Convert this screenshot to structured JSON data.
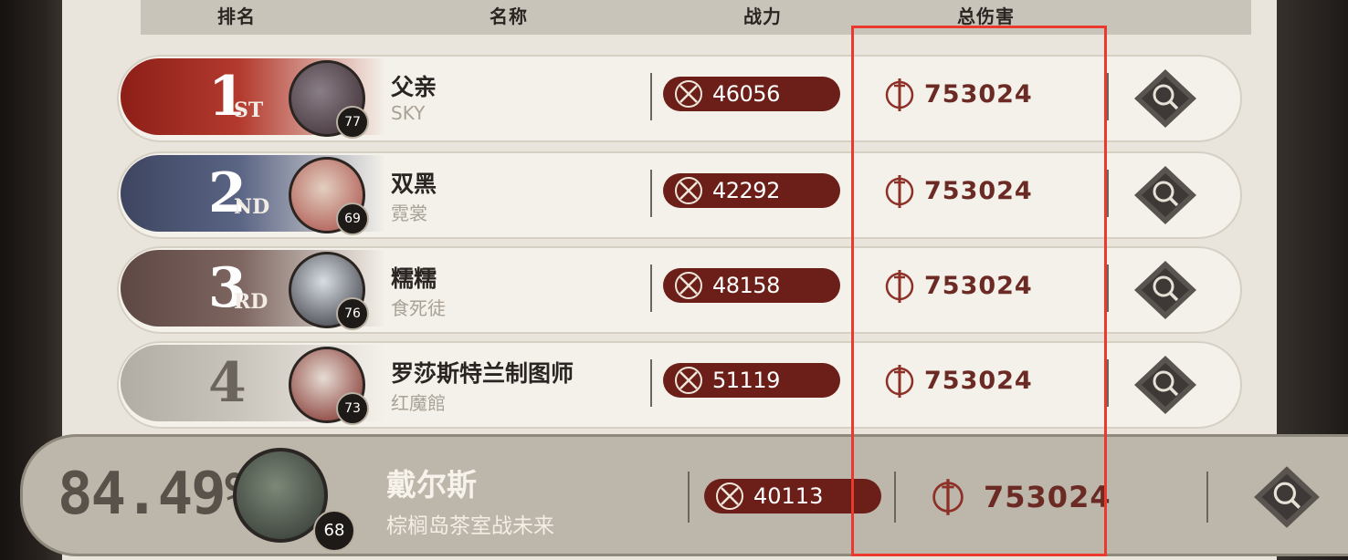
{
  "header": {
    "col_rank": "排名",
    "col_name": "名称",
    "col_power": "战力",
    "col_damage": "总伤害"
  },
  "rows": [
    {
      "rank_num": "1",
      "rank_suffix": "ST",
      "name": "父亲",
      "guild": "SKY",
      "level": "77",
      "power": "46056",
      "damage": "753024",
      "badge_color": "#9f2a22"
    },
    {
      "rank_num": "2",
      "rank_suffix": "ND",
      "name": "双黑",
      "guild": "霓裳",
      "level": "69",
      "power": "42292",
      "damage": "753024",
      "badge_color": "#4c5570"
    },
    {
      "rank_num": "3",
      "rank_suffix": "RD",
      "name": "糯糯",
      "guild": "食死徒",
      "level": "76",
      "power": "48158",
      "damage": "753024",
      "badge_color": "#6e5852"
    },
    {
      "rank_num": "4",
      "rank_suffix": "",
      "name": "罗莎斯特兰制图师",
      "guild": "红魔館",
      "level": "73",
      "power": "51119",
      "damage": "753024",
      "badge_color": "#b5b0a8"
    }
  ],
  "mine": {
    "percent": "84.49%",
    "name": "戴尔斯",
    "guild": "棕榈岛茶室战未来",
    "level": "68",
    "power": "40113",
    "damage": "753024"
  },
  "icons": {
    "power": "crossed-swords-icon",
    "damage": "dagger-shield-icon",
    "inspect": "magnifier-icon"
  },
  "colors": {
    "power_pill": "#6b1f18",
    "damage_text": "#6b2a24",
    "highlight": "#ea3a2e"
  }
}
